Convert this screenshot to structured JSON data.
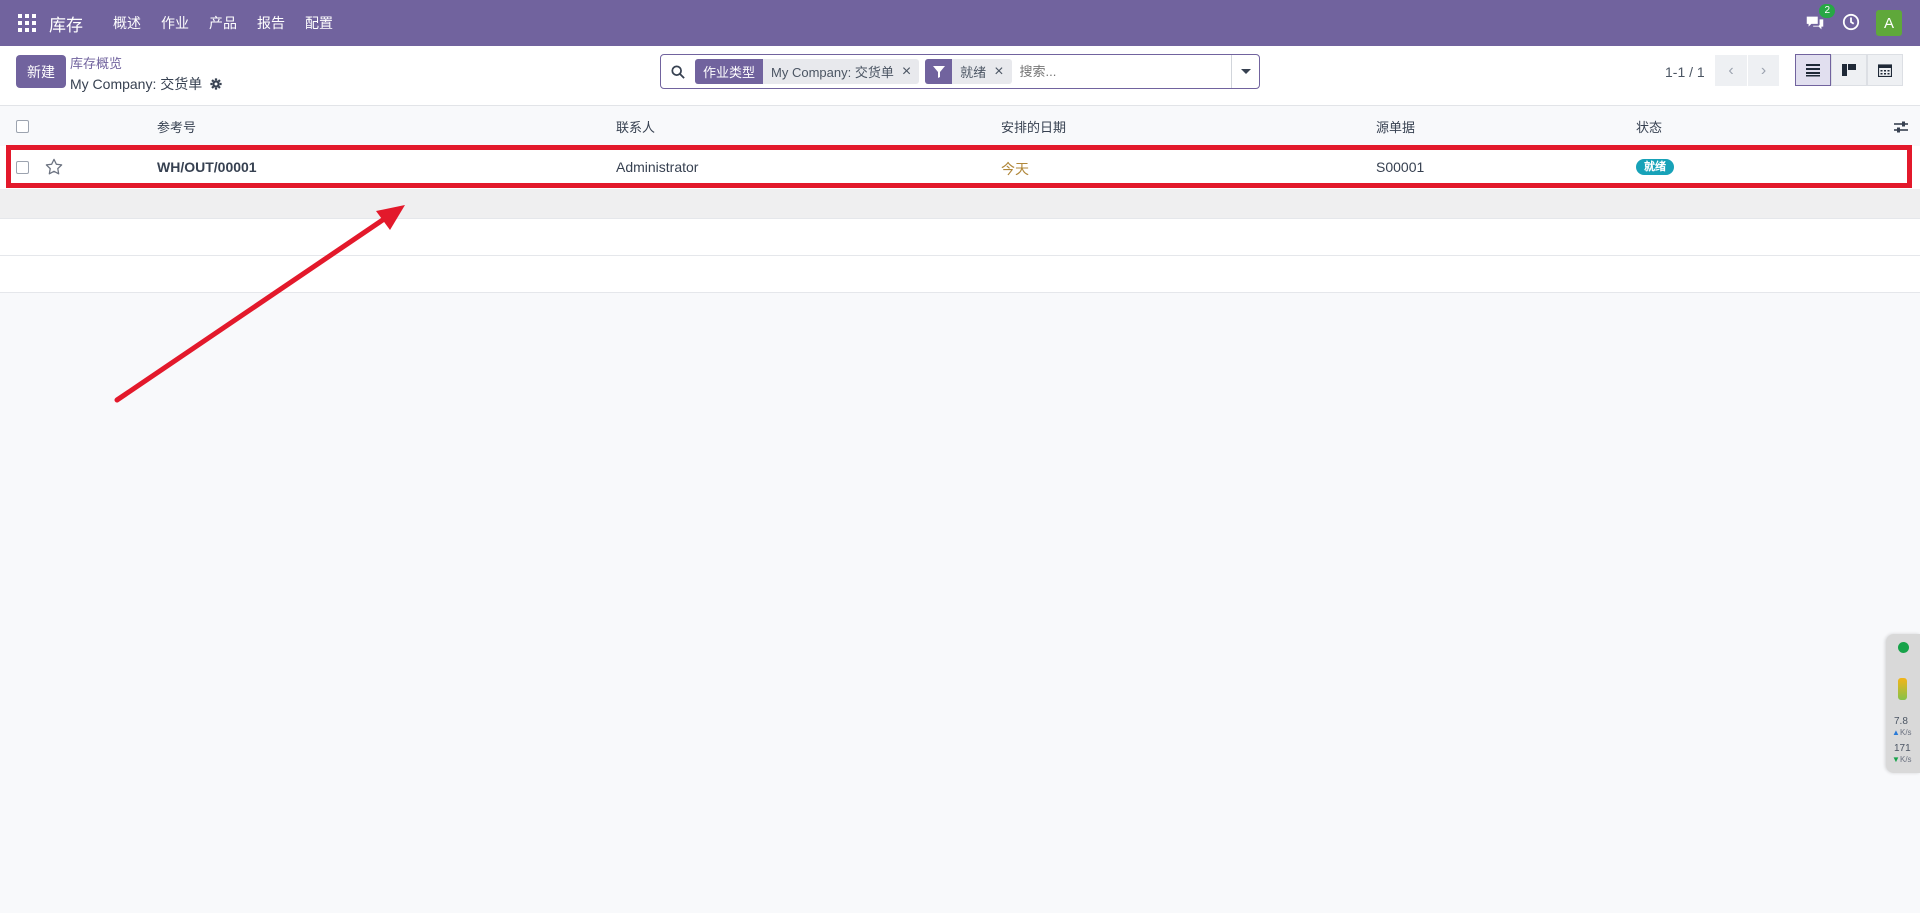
{
  "navbar": {
    "app_title": "库存",
    "menu": [
      "概述",
      "作业",
      "产品",
      "报告",
      "配置"
    ],
    "chat_count": "2",
    "avatar_letter": "A",
    "bg_color": "#71639e"
  },
  "control": {
    "new_label": "新建",
    "breadcrumb_parent": "库存概览",
    "breadcrumb_current": "My Company: 交货单",
    "search": {
      "facet1_label": "作业类型",
      "facet1_value": "My Company: 交货单",
      "facet2_value": "就绪",
      "placeholder": "搜索..."
    },
    "pager": "1-1 / 1"
  },
  "list": {
    "headers": {
      "reference": "参考号",
      "contact": "联系人",
      "scheduled_date": "安排的日期",
      "source_document": "源单据",
      "status": "状态"
    },
    "rows": [
      {
        "reference": "WH/OUT/00001",
        "contact": "Administrator",
        "scheduled_date": "今天",
        "source_document": "S00001",
        "status": "就绪"
      }
    ]
  },
  "side_widget": {
    "upload_value": "7.8",
    "upload_unit": "K/s",
    "download_value": "171",
    "download_unit": "K/s"
  }
}
